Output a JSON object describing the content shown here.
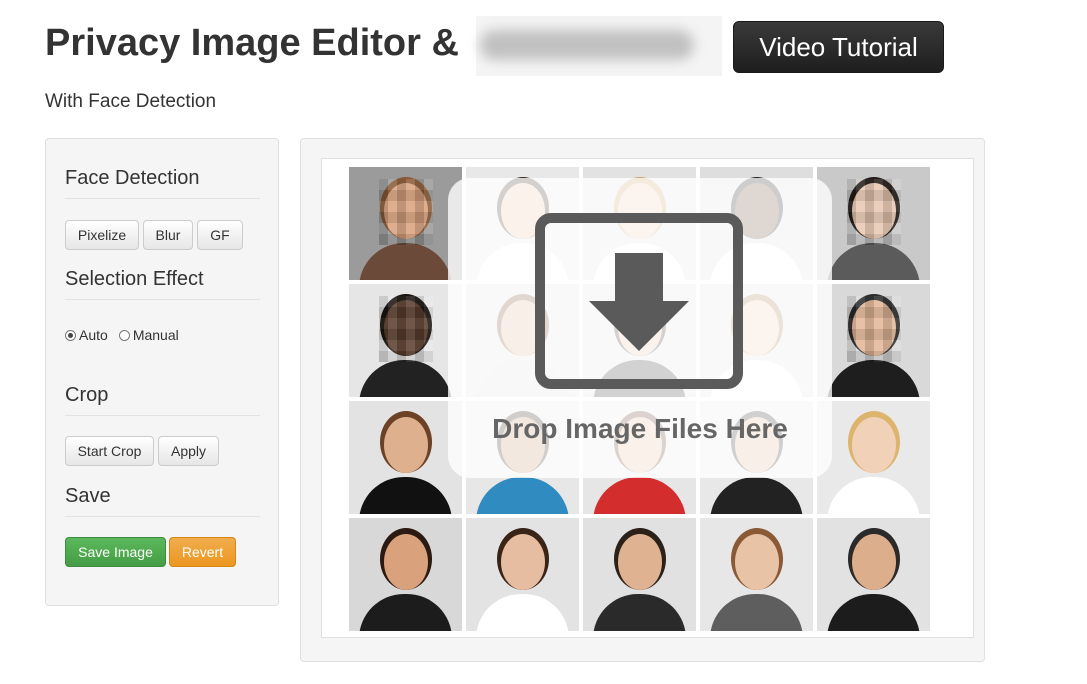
{
  "header": {
    "title": "Privacy Image Editor &",
    "video_button": "Video Tutorial",
    "subtitle": "With Face Detection"
  },
  "sidebar": {
    "face_detection": {
      "title": "Face Detection",
      "buttons": [
        "Pixelize",
        "Blur",
        "GF"
      ]
    },
    "selection_effect": {
      "title": "Selection Effect",
      "options": [
        {
          "label": "Auto",
          "checked": true
        },
        {
          "label": "Manual",
          "checked": false
        }
      ]
    },
    "crop": {
      "title": "Crop",
      "buttons": [
        "Start Crop",
        "Apply"
      ]
    },
    "save": {
      "title": "Save",
      "save_button": "Save Image",
      "revert_button": "Revert"
    }
  },
  "editor": {
    "drop_text": "Drop Image Files Here",
    "drop_icon": "download-arrow-icon",
    "photos": [
      {
        "skin": "#d9a27e",
        "hair": "#8a5a35",
        "shirt": "#6b4a3a",
        "bg": "#9b9b9b",
        "pixelated": true
      },
      {
        "skin": "#e7c2a6",
        "hair": "#3b2b22",
        "shirt": "#ffffff",
        "bg": "#e8e8e8",
        "pixelated": false
      },
      {
        "skin": "#f0cfb4",
        "hair": "#c7a46a",
        "shirt": "#ffffff",
        "bg": "#e2e2e2",
        "pixelated": false
      },
      {
        "skin": "#6b4b35",
        "hair": "#1e1e1e",
        "shirt": "#ffffff",
        "bg": "#dedede",
        "pixelated": false
      },
      {
        "skin": "#e8c8b2",
        "hair": "#241c18",
        "shirt": "#5b5b5b",
        "bg": "#c9c9c9",
        "pixelated": true
      },
      {
        "skin": "#5a3e2e",
        "hair": "#1a1410",
        "shirt": "#222222",
        "bg": "#e6e6e6",
        "pixelated": true
      },
      {
        "skin": "#e2b79a",
        "hair": "#7b4a2a",
        "shirt": "#dddddd",
        "bg": "#e3e3e3",
        "pixelated": false
      },
      {
        "skin": "#e9c2a7",
        "hair": "#3a2a20",
        "shirt": "#333333",
        "bg": "#e5e5e5",
        "pixelated": false
      },
      {
        "skin": "#f0cdb2",
        "hair": "#a57c4e",
        "shirt": "#ffffff",
        "bg": "#e4e4e4",
        "pixelated": false
      },
      {
        "skin": "#e3b797",
        "hair": "#2b2b2b",
        "shirt": "#1e1e1e",
        "bg": "#d9d9d9",
        "pixelated": true
      },
      {
        "skin": "#deb08e",
        "hair": "#6b4226",
        "shirt": "#111111",
        "bg": "#e3e3e3",
        "pixelated": false
      },
      {
        "skin": "#c99574",
        "hair": "#2b1d15",
        "shirt": "#2f8bc0",
        "bg": "#e7e7e7",
        "pixelated": false
      },
      {
        "skin": "#e7c0a0",
        "hair": "#5a3a26",
        "shirt": "#d32d2d",
        "bg": "#e6e6e6",
        "pixelated": false
      },
      {
        "skin": "#e0b597",
        "hair": "#2a2a2a",
        "shirt": "#222222",
        "bg": "#e8e8e8",
        "pixelated": false
      },
      {
        "skin": "#f1d1b7",
        "hair": "#dcb46e",
        "shirt": "#ffffff",
        "bg": "#e9e9e9",
        "pixelated": false
      },
      {
        "skin": "#d9a27c",
        "hair": "#2a1a12",
        "shirt": "#1c1c1c",
        "bg": "#d8d8d8",
        "pixelated": false
      },
      {
        "skin": "#e6bda0",
        "hair": "#3a2418",
        "shirt": "#ffffff",
        "bg": "#e3e3e3",
        "pixelated": false
      },
      {
        "skin": "#dfb391",
        "hair": "#2b2118",
        "shirt": "#2a2a2a",
        "bg": "#e1e1e1",
        "pixelated": false
      },
      {
        "skin": "#e9c3a6",
        "hair": "#8a5a36",
        "shirt": "#5e5e5e",
        "bg": "#e7e7e7",
        "pixelated": false
      },
      {
        "skin": "#dcae8c",
        "hair": "#2a2a2a",
        "shirt": "#1c1c1c",
        "bg": "#e2e2e2",
        "pixelated": false
      }
    ]
  }
}
